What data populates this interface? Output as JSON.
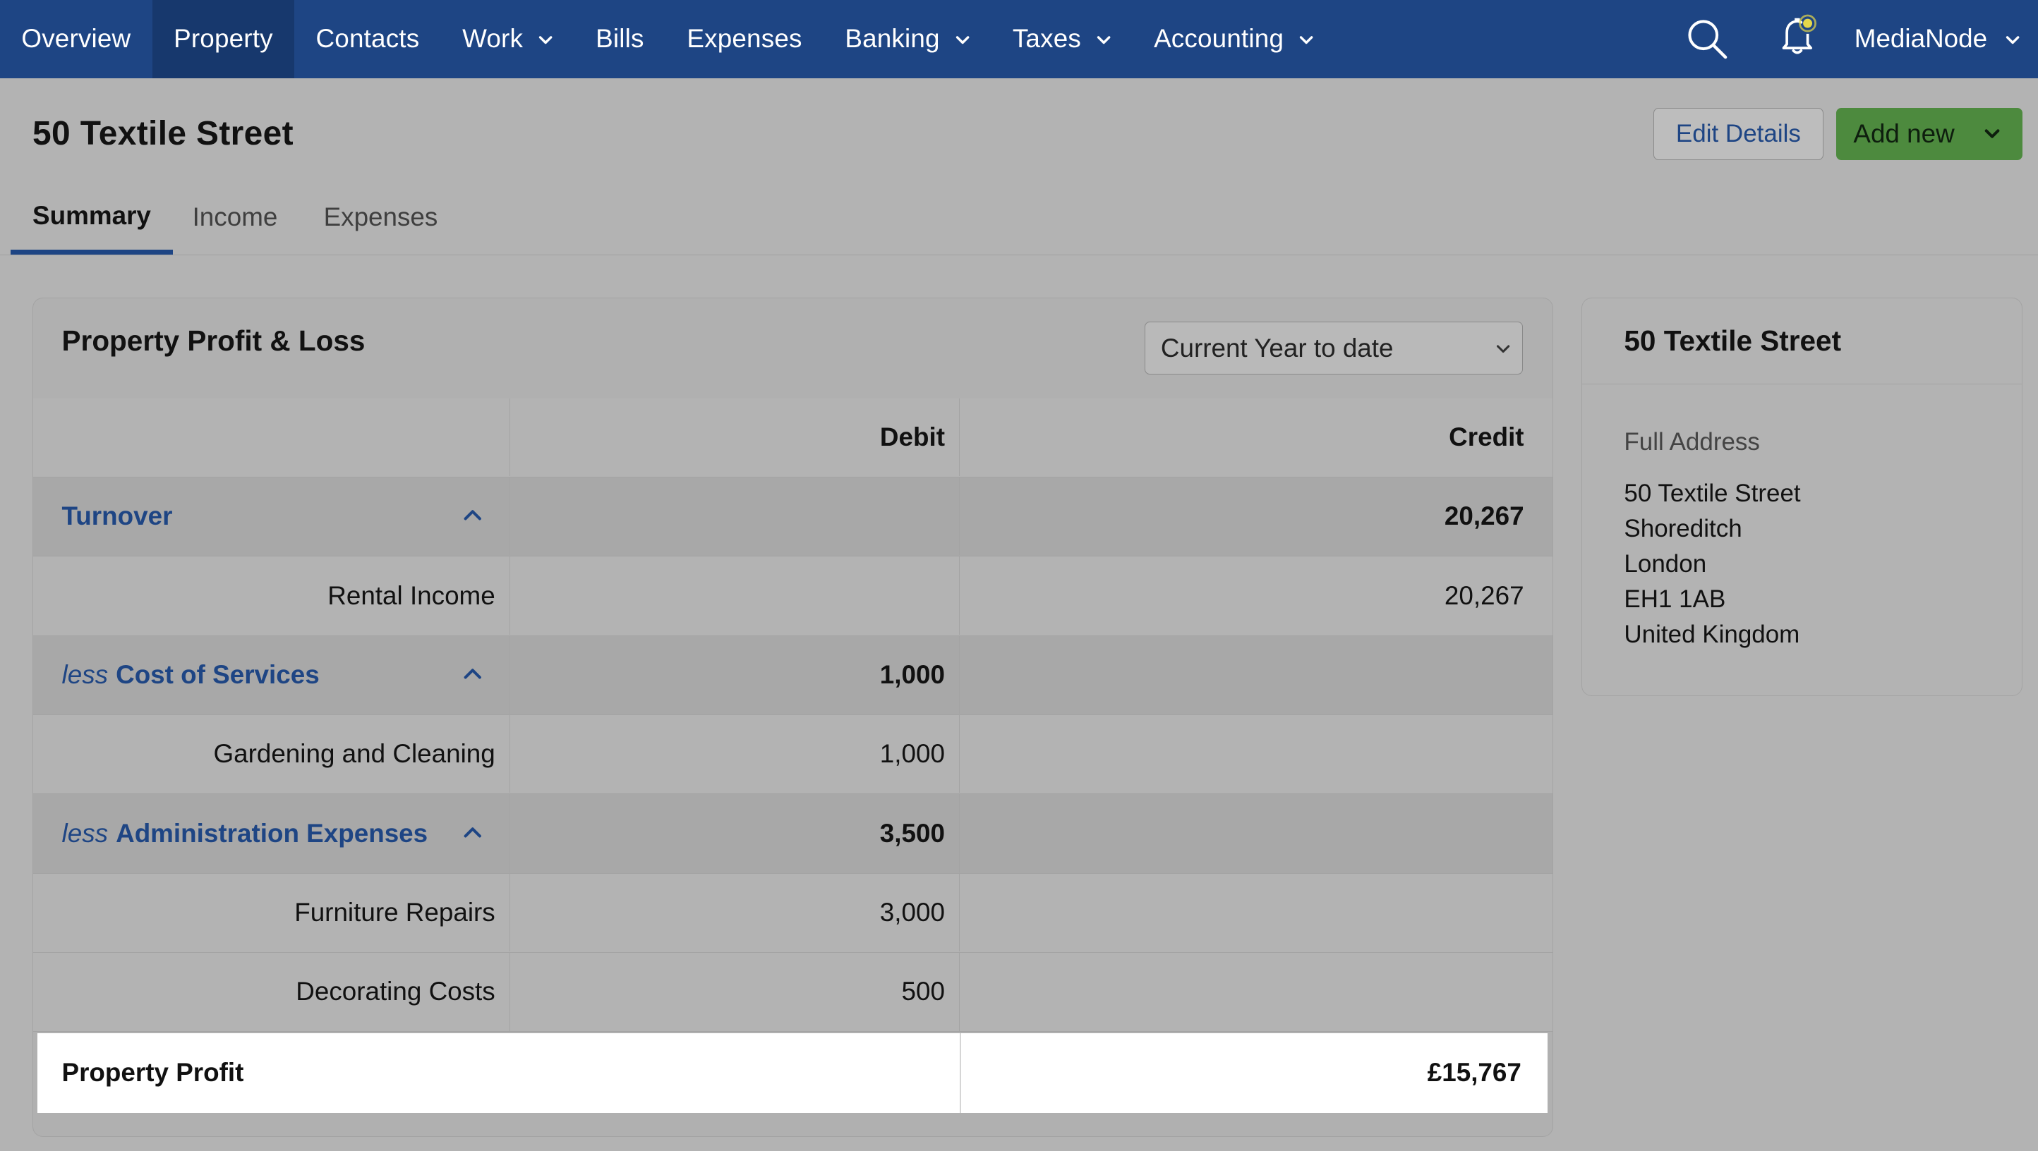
{
  "nav": {
    "items": [
      {
        "label": "Overview",
        "has_dropdown": false,
        "active": false
      },
      {
        "label": "Property",
        "has_dropdown": false,
        "active": true
      },
      {
        "label": "Contacts",
        "has_dropdown": false,
        "active": false
      },
      {
        "label": "Work",
        "has_dropdown": true,
        "active": false
      },
      {
        "label": "Bills",
        "has_dropdown": false,
        "active": false
      },
      {
        "label": "Expenses",
        "has_dropdown": false,
        "active": false
      },
      {
        "label": "Banking",
        "has_dropdown": true,
        "active": false
      },
      {
        "label": "Taxes",
        "has_dropdown": true,
        "active": false
      },
      {
        "label": "Accounting",
        "has_dropdown": true,
        "active": false
      }
    ],
    "user_label": "MediaNode",
    "search_icon": "search-icon",
    "notification_icon": "bell-icon"
  },
  "header": {
    "title": "50 Textile Street",
    "edit_label": "Edit Details",
    "add_label": "Add new"
  },
  "tabs": [
    {
      "label": "Summary",
      "active": true
    },
    {
      "label": "Income",
      "active": false
    },
    {
      "label": "Expenses",
      "active": false
    }
  ],
  "pnl": {
    "title": "Property Profit & Loss",
    "period": "Current Year to date",
    "columns": {
      "debit": "Debit",
      "credit": "Credit"
    },
    "groups": [
      {
        "prefix": "",
        "label": "Turnover",
        "debit": "",
        "credit": "20,267",
        "items": [
          {
            "label": "Rental Income",
            "debit": "",
            "credit": "20,267"
          }
        ]
      },
      {
        "prefix": "less",
        "label": "Cost of Services",
        "debit": "1,000",
        "credit": "",
        "items": [
          {
            "label": "Gardening and Cleaning",
            "debit": "1,000",
            "credit": ""
          }
        ]
      },
      {
        "prefix": "less",
        "label": "Administration Expenses",
        "debit": "3,500",
        "credit": "",
        "items": [
          {
            "label": "Furniture Repairs",
            "debit": "3,000",
            "credit": ""
          },
          {
            "label": "Decorating Costs",
            "debit": "500",
            "credit": ""
          }
        ]
      }
    ],
    "total_label": "Property Profit",
    "total_value": "£15,767"
  },
  "property_card": {
    "title": "50 Textile Street",
    "address_label": "Full Address",
    "address_lines": [
      "50 Textile Street",
      "Shoreditch",
      "London",
      "EH1 1AB",
      "United Kingdom"
    ]
  },
  "colors": {
    "nav_bg": "#1e4584",
    "nav_active": "#17386d",
    "accent": "#1e4584",
    "add_button": "#4d8a3e",
    "notification_dot": "#e6d84a"
  }
}
